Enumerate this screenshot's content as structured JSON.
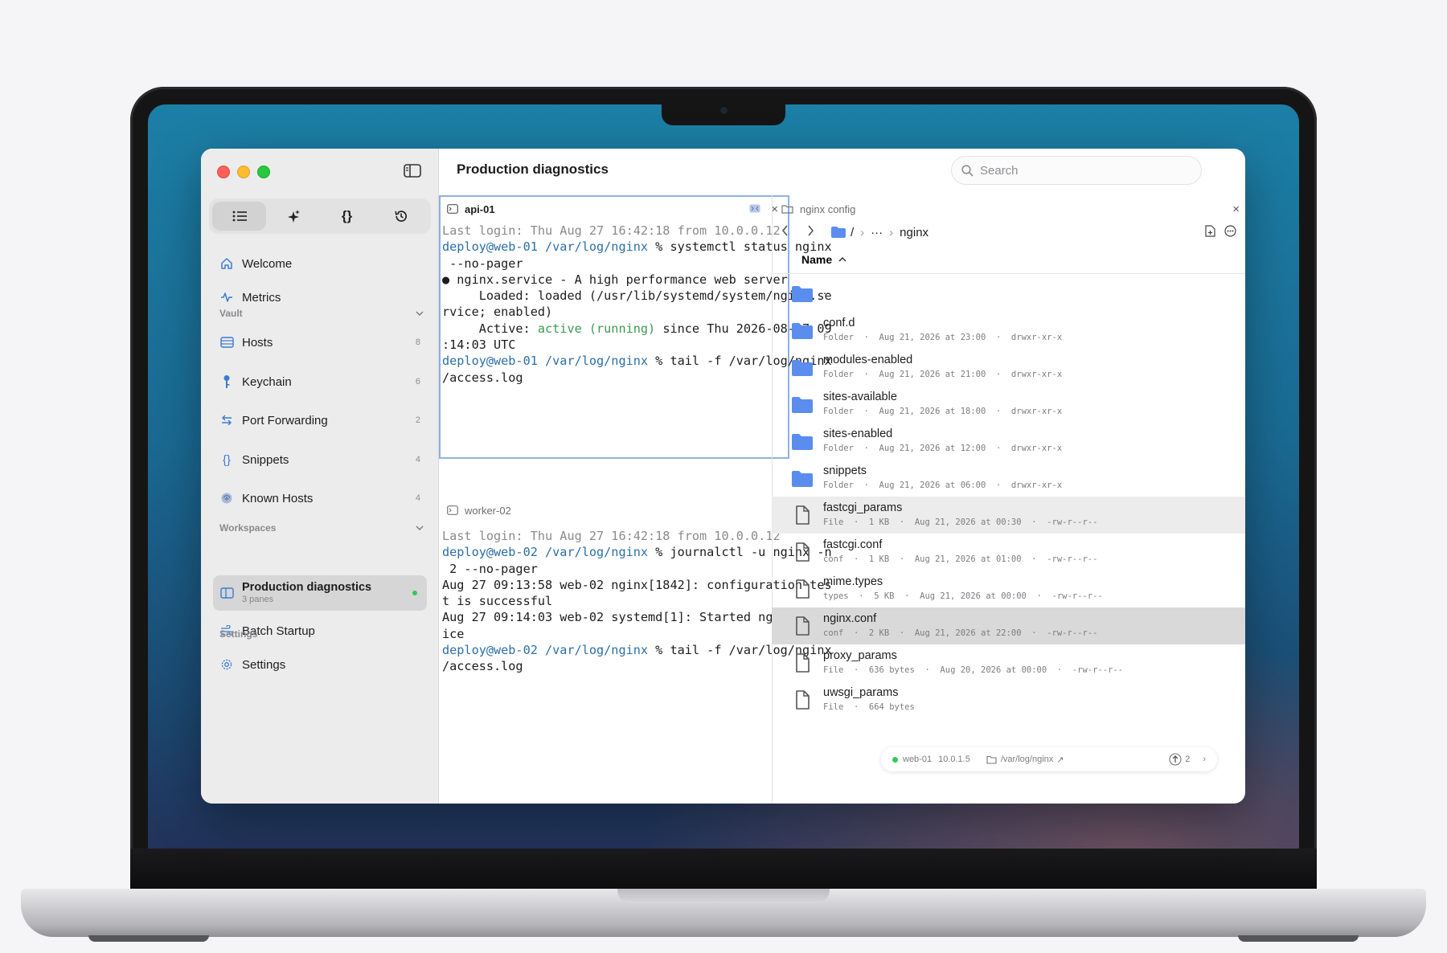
{
  "window": {
    "title": "Production diagnostics"
  },
  "search": {
    "placeholder": "Search"
  },
  "sidebar": {
    "nav": [
      {
        "label": "Welcome"
      },
      {
        "label": "Metrics"
      }
    ],
    "vault_header": "Vault",
    "vault": [
      {
        "label": "Hosts",
        "count": "8"
      },
      {
        "label": "Keychain",
        "count": "6"
      },
      {
        "label": "Port Forwarding",
        "count": "2"
      },
      {
        "label": "Snippets",
        "count": "4"
      },
      {
        "label": "Known Hosts",
        "count": "4"
      }
    ],
    "workspaces_header": "Workspaces",
    "workspaces": [
      {
        "label": "Production diagnostics",
        "sub": "3 panes"
      },
      {
        "label": "Batch Startup"
      }
    ],
    "settings_header": "Settings",
    "settings": {
      "label": "Settings"
    }
  },
  "terminals": [
    {
      "tab": "api-01",
      "lines": [
        "Last login: Thu Aug 27 16:42:18 from 10.0.0.12",
        "deploy@web-01 /var/log/nginx % systemctl status nginx",
        " --no-pager",
        "● nginx.service - A high performance web server",
        "     Loaded: loaded (/usr/lib/systemd/system/nginx.se",
        "rvice; enabled)",
        "     Active: active (running) since Thu 2026-08-27 09",
        ":14:03 UTC",
        "deploy@web-01 /var/log/nginx % tail -f /var/log/nginx",
        "/access.log"
      ]
    },
    {
      "tab": "worker-02",
      "lines": [
        "Last login: Thu Aug 27 16:42:18 from 10.0.0.12",
        "deploy@web-02 /var/log/nginx % journalctl -u nginx -n",
        " 2 --no-pager",
        "Aug 27 09:13:58 web-02 nginx[1842]: configuration tes",
        "t is successful",
        "Aug 27 09:14:03 web-02 systemd[1]: Started nginx.serv",
        "ice",
        "deploy@web-02 /var/log/nginx % tail -f /var/log/nginx",
        "/access.log"
      ]
    }
  ],
  "file_browser": {
    "tab": "nginx config",
    "path_root": "/",
    "path_ellipsis": "···",
    "path_current": "nginx",
    "column_header": "Name",
    "parent": "..",
    "files": [
      {
        "name": "conf.d",
        "kind": "Folder",
        "size": "",
        "date": "Aug 21, 2026 at 23:00",
        "perm": "drwxr-xr-x",
        "type": "folder"
      },
      {
        "name": "modules-enabled",
        "kind": "Folder",
        "size": "",
        "date": "Aug 21, 2026 at 21:00",
        "perm": "drwxr-xr-x",
        "type": "folder"
      },
      {
        "name": "sites-available",
        "kind": "Folder",
        "size": "",
        "date": "Aug 21, 2026 at 18:00",
        "perm": "drwxr-xr-x",
        "type": "folder"
      },
      {
        "name": "sites-enabled",
        "kind": "Folder",
        "size": "",
        "date": "Aug 21, 2026 at 12:00",
        "perm": "drwxr-xr-x",
        "type": "folder"
      },
      {
        "name": "snippets",
        "kind": "Folder",
        "size": "",
        "date": "Aug 21, 2026 at 06:00",
        "perm": "drwxr-xr-x",
        "type": "folder"
      },
      {
        "name": "fastcgi_params",
        "kind": "File",
        "size": "1 KB",
        "date": "Aug 21, 2026 at 00:30",
        "perm": "-rw-r--r--",
        "type": "file"
      },
      {
        "name": "fastcgi.conf",
        "kind": "conf",
        "size": "1 KB",
        "date": "Aug 21, 2026 at 01:00",
        "perm": "-rw-r--r--",
        "type": "file"
      },
      {
        "name": "mime.types",
        "kind": "types",
        "size": "5 KB",
        "date": "Aug 21, 2026 at 00:00",
        "perm": "-rw-r--r--",
        "type": "file"
      },
      {
        "name": "nginx.conf",
        "kind": "conf",
        "size": "2 KB",
        "date": "Aug 21, 2026 at 22:00",
        "perm": "-rw-r--r--",
        "type": "file"
      },
      {
        "name": "proxy_params",
        "kind": "File",
        "size": "636 bytes",
        "date": "Aug 20, 2026 at 00:00",
        "perm": "-rw-r--r--",
        "type": "file"
      },
      {
        "name": "uwsgi_params",
        "kind": "File",
        "size": "664 bytes",
        "date": "",
        "perm": "",
        "type": "file"
      }
    ]
  },
  "status_bar": {
    "host": "web-01",
    "ip": "10.0.1.5",
    "path": "/var/log/nginx",
    "transfers": "2"
  },
  "colors": {
    "accent": "#2c6fa8",
    "folder": "#5b8def",
    "status_green": "#34c759",
    "selection": "#8fb1e0"
  }
}
